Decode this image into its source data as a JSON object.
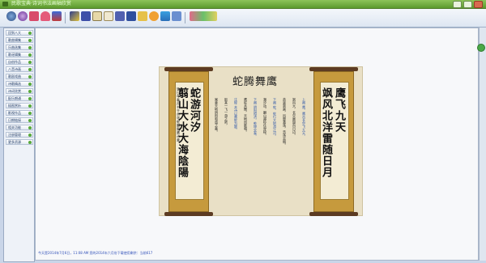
{
  "window": {
    "title": "民歌宝典·诗词书法画轴欣赏"
  },
  "toolbar": {
    "icons": [
      "home-icon",
      "globe-icon",
      "music-icon",
      "heart-icon",
      "image-icon",
      "palette-icon",
      "grid-icon",
      "book-icon",
      "edit-icon",
      "video-icon",
      "save-icon",
      "folder-icon",
      "settings-icon",
      "photo-icon",
      "help-icon",
      "tools-icon"
    ]
  },
  "sidebar": {
    "items": [
      {
        "label": "回到八大"
      },
      {
        "label": "歌曲辑集"
      },
      {
        "label": "乐曲选集"
      },
      {
        "label": "歌谣辑集"
      },
      {
        "label": "自创作品"
      },
      {
        "label": "八音诗画"
      },
      {
        "label": "歌剧戏曲"
      },
      {
        "label": "诗歌精选"
      },
      {
        "label": "诗词欣赏"
      },
      {
        "label": "配乐朗诵"
      },
      {
        "label": "插图赏析"
      },
      {
        "label": "影视作品"
      },
      {
        "label": "日期链接"
      },
      {
        "label": "相关功能"
      },
      {
        "label": "注册管理"
      },
      {
        "label": "更多资源"
      }
    ]
  },
  "painting": {
    "title": "蛇腾舞鹰",
    "right_scroll": {
      "lines": [
        "鹰飞九天",
        "飒风北洋雷随日月"
      ]
    },
    "left_scroll": {
      "lines": [
        "蛇游河汐",
        "翦山大水大海陰陽"
      ],
      "inscription": "癸巳年春月书于京华蛇腾舞鹰诗意"
    },
    "poem_columns": [
      "上阕  鹰，鹰击长空飞九天，",
      "飒风大，长空展翅向日边。",
      "英姿飒爽，风雷激荡，浩荡云烟。",
      "下阕  蛇，蛇行大地游江河，",
      "潮汐动，翻山越岭任穿梭。",
      "下阕  阴阳相济，乾坤交泰，",
      "鹰蛇共舞，天地同歌唱。",
      "注释  本诗以鹰蛇为题，",
      "取其一飞一游之势，",
      "寓意天地阴阳和谐之美。"
    ]
  },
  "status": {
    "text": "今天是2014年7月6日，11:08 AM  您的2014年六月份下载使用剩余：当前617"
  }
}
